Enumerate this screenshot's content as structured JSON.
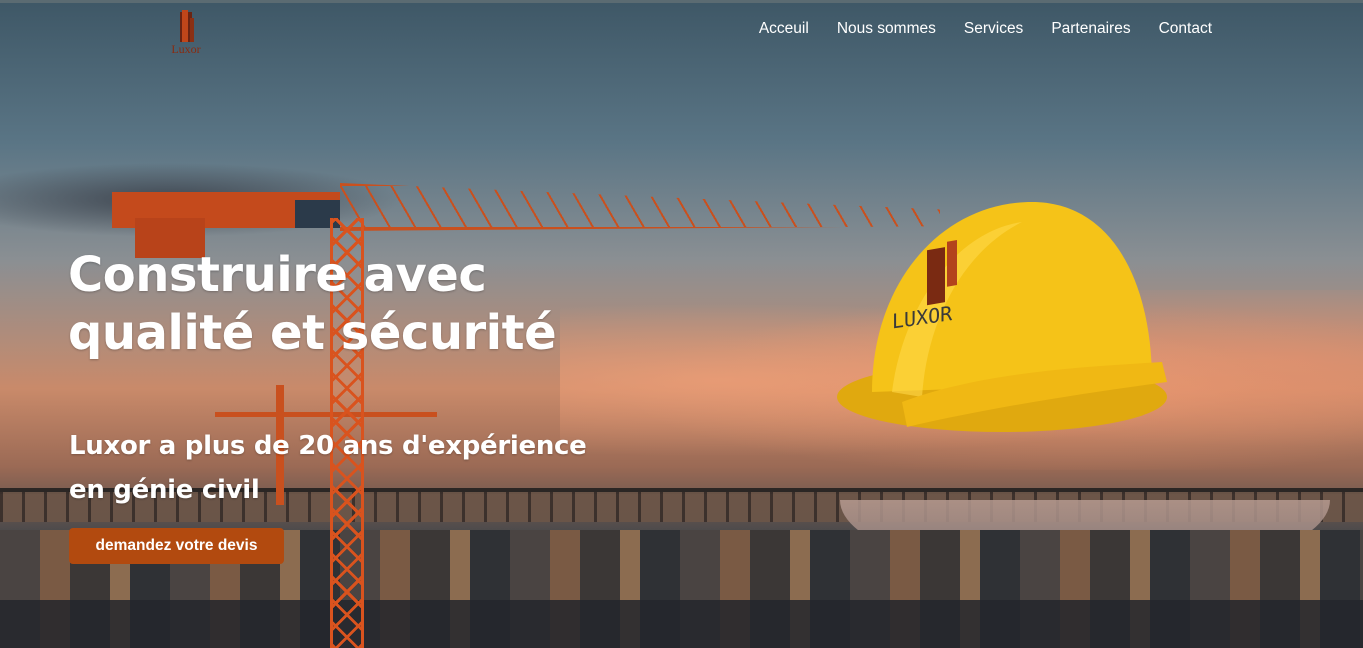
{
  "brand": {
    "logo_text": "Luxor",
    "accent": "#b24a0f"
  },
  "nav": {
    "items": [
      {
        "label": "Acceuil"
      },
      {
        "label": "Nous sommes"
      },
      {
        "label": "Services"
      },
      {
        "label": "Partenaires"
      },
      {
        "label": "Contact"
      }
    ]
  },
  "hero": {
    "headline_line1": "Construire avec",
    "headline_line2": "qualité et sécurité",
    "subline_line1": "Luxor a plus de 20 ans d'expérience",
    "subline_line2": "en génie civil",
    "cta_label": "demandez votre devis",
    "helmet_brand": "LUXOR",
    "helmet_color": "#f5c318"
  }
}
